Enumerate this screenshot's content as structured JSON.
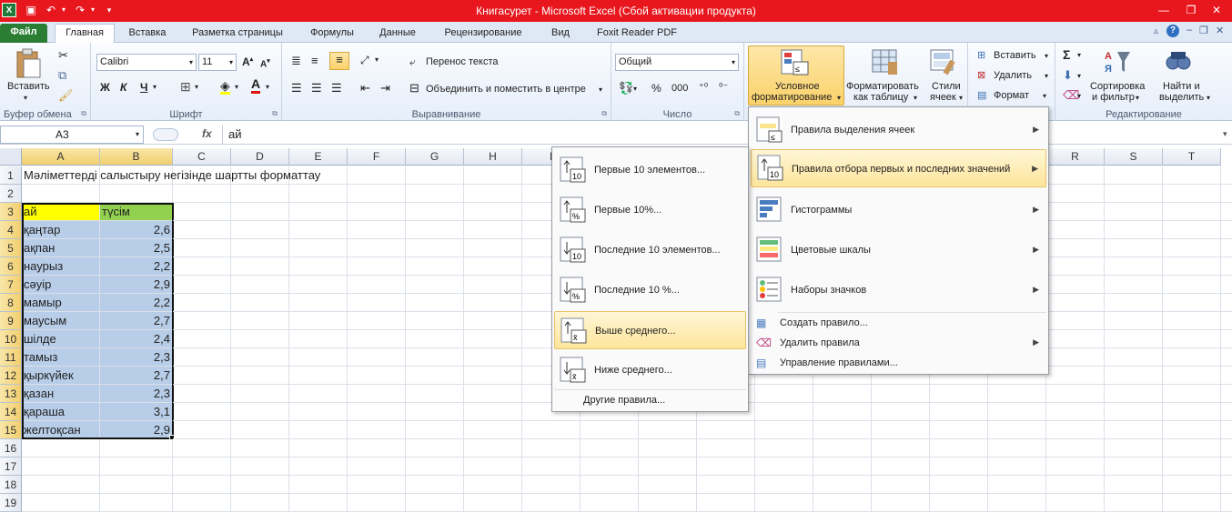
{
  "title": "Книгасурет  -  Microsoft Excel (Сбой активации продукта)",
  "tabs": [
    "Файл",
    "Главная",
    "Вставка",
    "Разметка страницы",
    "Формулы",
    "Данные",
    "Рецензирование",
    "Вид",
    "Foxit Reader PDF"
  ],
  "ribbon": {
    "paste": "Вставить",
    "font_name": "Calibri",
    "font_size": "11",
    "wrap_text": "Перенос текста",
    "merge_center": "Объединить и поместить в центре",
    "number_format": "Общий",
    "cond_format_1": "Условное",
    "cond_format_2": "форматирование",
    "format_table_1": "Форматировать",
    "format_table_2": "как таблицу",
    "styles_1": "Стили",
    "styles_2": "ячеек",
    "insert": "Вставить",
    "delete": "Удалить",
    "format": "Формат",
    "sort_1": "Сортировка",
    "sort_2": "и фильтр",
    "find_1": "Найти и",
    "find_2": "выделить",
    "groups": {
      "clipboard": "Буфер обмена",
      "font": "Шрифт",
      "alignment": "Выравнивание",
      "number": "Число",
      "editing": "Редактирование"
    },
    "bold": "Ж",
    "italic": "К",
    "underline": "Ч",
    "percent": "%",
    "thousands": "000"
  },
  "formula_bar": {
    "name_box": "A3",
    "fx": "fx",
    "value": "ай"
  },
  "columns": [
    "A",
    "B",
    "C",
    "D",
    "E",
    "F",
    "G",
    "H",
    "I",
    "J",
    "K",
    "L",
    "M",
    "N",
    "O",
    "P",
    "Q",
    "R",
    "S",
    "T"
  ],
  "rows": [
    "1",
    "2",
    "3",
    "4",
    "5",
    "6",
    "7",
    "8",
    "9",
    "10",
    "11",
    "12",
    "13",
    "14",
    "15",
    "16",
    "17",
    "18",
    "19"
  ],
  "sheet": {
    "a1": "Мәліметтерді салыстыру негізінде шартты форматтау",
    "header": [
      "ай",
      "түсім"
    ],
    "data": [
      [
        "қаңтар",
        "2,6"
      ],
      [
        "ақпан",
        "2,5"
      ],
      [
        "наурыз",
        "2,2"
      ],
      [
        "сәуір",
        "2,9"
      ],
      [
        "мамыр",
        "2,2"
      ],
      [
        "маусым",
        "2,7"
      ],
      [
        "шілде",
        "2,4"
      ],
      [
        "тамыз",
        "2,3"
      ],
      [
        "қыркүйек",
        "2,7"
      ],
      [
        "қазан",
        "2,3"
      ],
      [
        "қараша",
        "3,1"
      ],
      [
        "желтоқсан",
        "2,9"
      ]
    ]
  },
  "cf_menu": {
    "items": [
      "Правила выделения ячеек",
      "Правила отбора первых и последних значений",
      "Гистограммы",
      "Цветовые шкалы",
      "Наборы значков"
    ],
    "actions": [
      "Создать правило...",
      "Удалить правила",
      "Управление правилами..."
    ]
  },
  "submenu": {
    "items": [
      "Первые 10 элементов...",
      "Первые 10%...",
      "Последние 10 элементов...",
      "Последние 10 %...",
      "Выше среднего...",
      "Ниже среднего..."
    ],
    "other": "Другие правила..."
  },
  "colors": {
    "title_bar": "#e8161d",
    "file_tab": "#2a7d33",
    "header_yellow": "#ffff00",
    "header_green": "#92d050",
    "selection": "#b7cde8",
    "highlight": "#fde59b"
  }
}
